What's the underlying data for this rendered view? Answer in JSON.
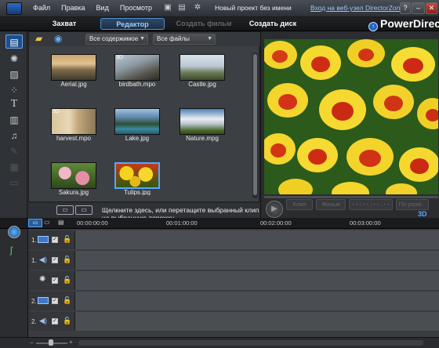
{
  "titlebar": {
    "menu": [
      "Файл",
      "Правка",
      "Вид",
      "Просмотр"
    ],
    "project": "Новый проект без имени",
    "link": "Вход на веб-узел DirectorZone",
    "window_buttons": [
      "?",
      "–",
      "□",
      "✕"
    ]
  },
  "modes": {
    "capture": "Захват",
    "editor": "Редактор",
    "create_film": "Создать фильм",
    "create_disc": "Создать диск"
  },
  "brand": "PowerDirector",
  "library": {
    "filter_content": "Все содержимое",
    "filter_files": "Все файлы",
    "items": [
      {
        "label": "Aerial.jpg"
      },
      {
        "label": "birdbath.mpo",
        "badge": "3D"
      },
      {
        "label": "Castle.jpg"
      },
      {
        "label": "harvest.mpo",
        "badge": "3D"
      },
      {
        "label": "Lake.jpg"
      },
      {
        "label": "Nature.mpg"
      },
      {
        "label": "Sakura.jpg"
      },
      {
        "label": "Tulips.jpg"
      }
    ]
  },
  "preview": {
    "clip_label": "Клип",
    "film_label": "Фильм",
    "timecode": "- - : - - : - - . - -",
    "fit_label": "По разм...",
    "threed_label": "3D"
  },
  "hint": "Щелкните здесь, или перетащите выбранный клип на выбранную дорожку.",
  "timeline": {
    "ruler": [
      "00:00:00:00",
      "00:01:00:00",
      "00:02:00:00",
      "00:03:00:00"
    ],
    "tracks": [
      {
        "number": "1."
      },
      {
        "number": "1."
      },
      {
        "number": ""
      },
      {
        "number": "2."
      },
      {
        "number": "2."
      }
    ]
  },
  "colors": {
    "accent": "#4f8fd3",
    "background": "#3a3c40",
    "link": "#9cc7ff"
  }
}
